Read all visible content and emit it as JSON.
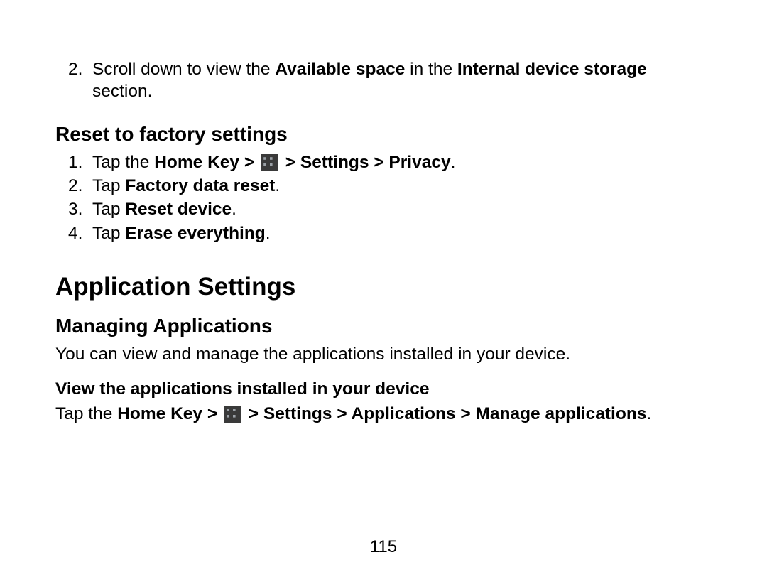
{
  "top_list": {
    "item2_num": "2.",
    "item2_segments": [
      {
        "t": "Scroll down to view the ",
        "b": false
      },
      {
        "t": "Available space",
        "b": true
      },
      {
        "t": " in the ",
        "b": false
      },
      {
        "t": "Internal device storage",
        "b": true
      },
      {
        "t": " section.",
        "b": false
      }
    ]
  },
  "reset_heading": "Reset to factory settings",
  "reset_steps": [
    {
      "num": "1.",
      "segments": [
        {
          "t": "Tap the ",
          "b": false
        },
        {
          "t": "Home Key > ",
          "b": true
        },
        {
          "t": "[ICON]",
          "icon": true
        },
        {
          "t": " > Settings > Privacy",
          "b": true
        },
        {
          "t": ".",
          "b": false
        }
      ]
    },
    {
      "num": "2.",
      "segments": [
        {
          "t": "Tap ",
          "b": false
        },
        {
          "t": "Factory data reset",
          "b": true
        },
        {
          "t": ".",
          "b": false
        }
      ]
    },
    {
      "num": "3.",
      "segments": [
        {
          "t": "Tap ",
          "b": false
        },
        {
          "t": "Reset device",
          "b": true
        },
        {
          "t": ".",
          "b": false
        }
      ]
    },
    {
      "num": "4.",
      "segments": [
        {
          "t": "Tap ",
          "b": false
        },
        {
          "t": "Erase everything",
          "b": true
        },
        {
          "t": ".",
          "b": false
        }
      ]
    }
  ],
  "app_settings_heading": "Application Settings",
  "managing_heading": "Managing Applications",
  "managing_desc": "You can view and manage the applications installed in your device.",
  "view_heading": "View the applications installed in your device",
  "view_segments": [
    {
      "t": "Tap the ",
      "b": false
    },
    {
      "t": "Home Key > ",
      "b": true
    },
    {
      "t": "[ICON]",
      "icon": true
    },
    {
      "t": " > Settings > Applications > Manage applications",
      "b": true
    },
    {
      "t": ".",
      "b": false
    }
  ],
  "page_number": "115"
}
